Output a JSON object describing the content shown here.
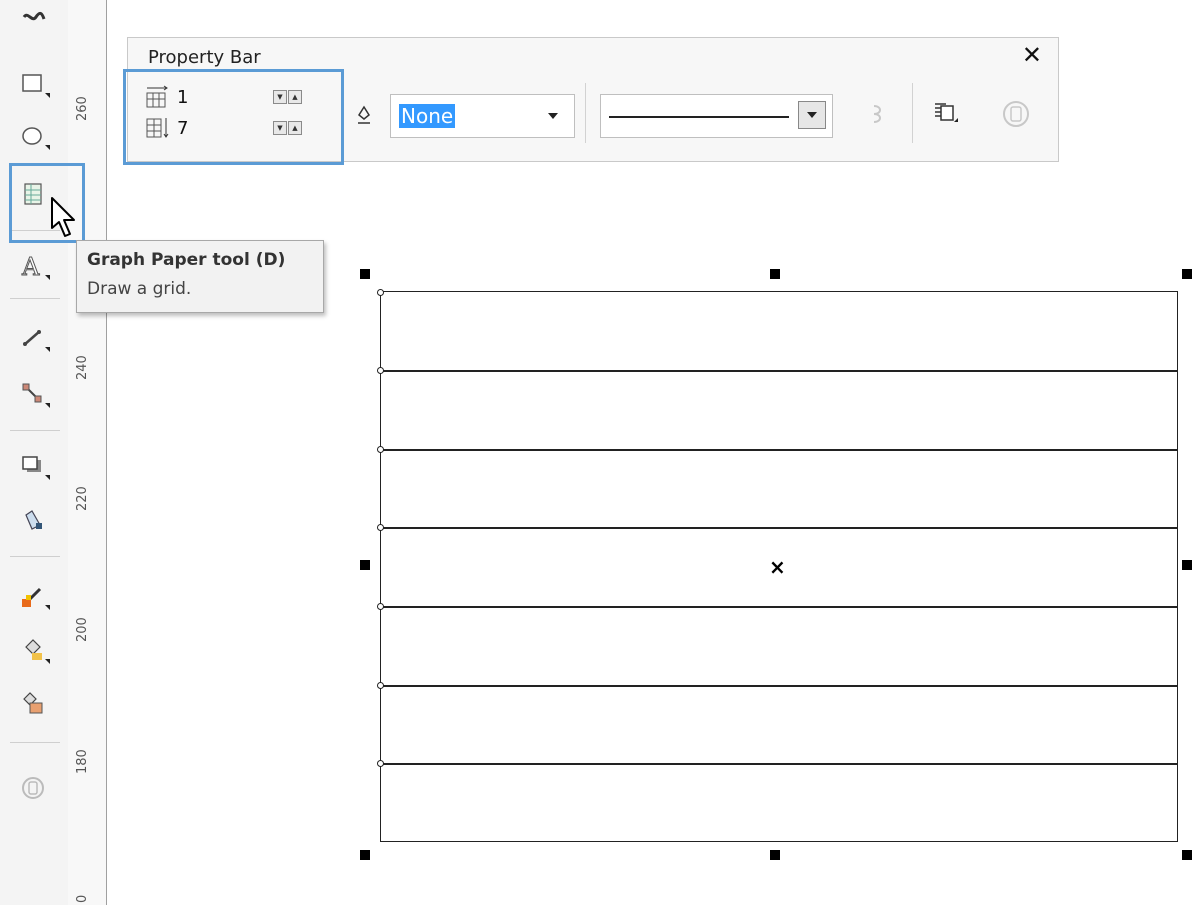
{
  "toolbox": {
    "tools": [
      {
        "name": "freehand-tool"
      },
      {
        "name": "rectangle-tool"
      },
      {
        "name": "ellipse-tool"
      },
      {
        "name": "graph-paper-tool"
      },
      {
        "name": "text-tool"
      },
      {
        "name": "dimension-tool"
      },
      {
        "name": "connector-tool"
      },
      {
        "name": "drop-shadow-tool"
      },
      {
        "name": "transparency-tool"
      },
      {
        "name": "eyedropper-tool"
      },
      {
        "name": "fill-tool"
      },
      {
        "name": "smart-fill-tool"
      },
      {
        "name": "disabled-tool"
      }
    ]
  },
  "ruler": {
    "labels": [
      "260",
      "240",
      "220",
      "200",
      "180",
      "0"
    ]
  },
  "property_bar": {
    "title": "Property Bar",
    "close_label": "✕",
    "columns_value": "1",
    "rows_value": "7",
    "outline_width_value": "None",
    "line_style": "solid",
    "accent_color": "#5b9bd5",
    "selection_color": "#3399ff"
  },
  "tooltip": {
    "title": "Graph Paper tool (D)",
    "description": "Draw a grid."
  },
  "canvas": {
    "grid_rows": 7,
    "grid_columns": 1,
    "center_mark": "×"
  }
}
